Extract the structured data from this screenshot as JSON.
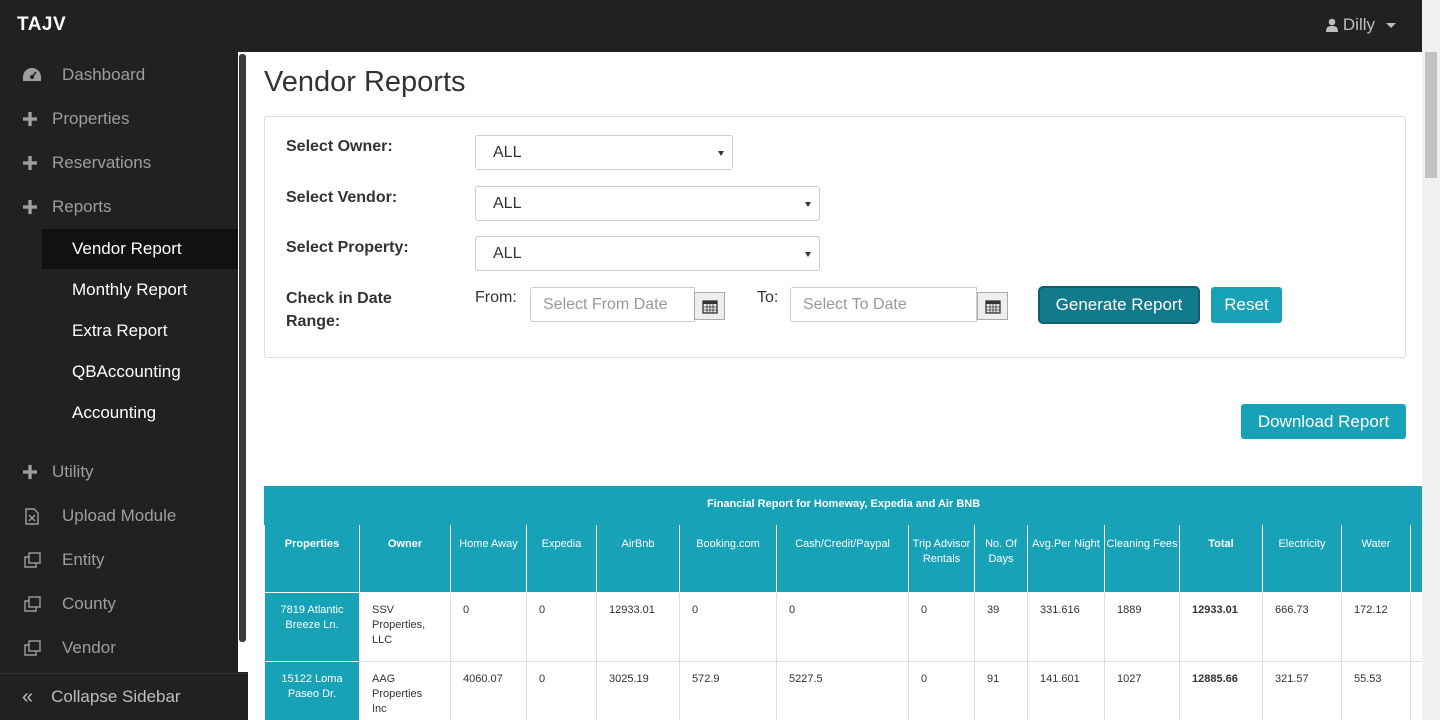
{
  "app": {
    "brand": "TAJV",
    "user": "Dilly"
  },
  "sidebar": {
    "items": [
      {
        "label": "Dashboard",
        "icon": "dashboard-icon"
      },
      {
        "label": "Properties",
        "icon": "plus-icon"
      },
      {
        "label": "Reservations",
        "icon": "plus-icon"
      },
      {
        "label": "Reports",
        "icon": "plus-icon"
      }
    ],
    "subitems": [
      {
        "label": "Vendor Report",
        "active": true
      },
      {
        "label": "Monthly Report"
      },
      {
        "label": "Extra Report"
      },
      {
        "label": "QBAccounting"
      },
      {
        "label": "Accounting"
      }
    ],
    "items2": [
      {
        "label": "Utility",
        "icon": "plus-icon"
      },
      {
        "label": "Upload Module",
        "icon": "file-excel-icon"
      },
      {
        "label": "Entity",
        "icon": "clone-icon"
      },
      {
        "label": "County",
        "icon": "clone-icon"
      },
      {
        "label": "Vendor",
        "icon": "clone-icon"
      }
    ],
    "collapse_label": "Collapse Sidebar"
  },
  "page": {
    "title": "Vendor Reports"
  },
  "filters": {
    "owner_label": "Select Owner:",
    "owner_value": "ALL",
    "vendor_label": "Select Vendor:",
    "vendor_value": "ALL",
    "property_label": "Select Property:",
    "property_value": "ALL",
    "date_range_label": "Check in Date Range:",
    "from_label": "From:",
    "from_placeholder": "Select From Date",
    "to_label": "To:",
    "to_placeholder": "Select To Date",
    "generate_label": "Generate Report",
    "reset_label": "Reset"
  },
  "download_label": "Download Report",
  "report": {
    "caption": "Financial Report for Homeway, Expedia and Air BNB",
    "columns": [
      "Properties",
      "Owner",
      "Home Away",
      "Expedia",
      "AirBnb",
      "Booking.com",
      "Cash/Credit/Paypal",
      "Trip Advisor Rentals",
      "No. Of Days",
      "Avg.Per Night",
      "Cleaning Fees",
      "Total",
      "Electricity",
      "Water",
      ""
    ],
    "rows": [
      [
        "7819 Atlantic Breeze Ln.",
        "SSV Properties, LLC",
        "0",
        "0",
        "12933.01",
        "0",
        "0",
        "0",
        "39",
        "331.616",
        "1889",
        "12933.01",
        "666.73",
        "172.12",
        ""
      ],
      [
        "15122 Loma Paseo Dr.",
        "AAG Properties Inc",
        "4060.07",
        "0",
        "3025.19",
        "572.9",
        "5227.5",
        "0",
        "91",
        "141.601",
        "1027",
        "12885.66",
        "321.57",
        "55.53",
        ""
      ]
    ]
  },
  "colors": {
    "accent": "#17a2b8",
    "navbar": "#212121"
  }
}
